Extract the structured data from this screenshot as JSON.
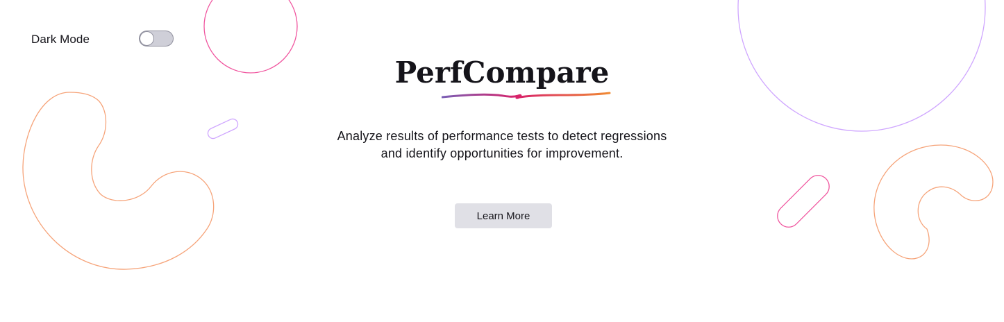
{
  "theme_toggle": {
    "label": "Dark Mode",
    "enabled": false
  },
  "hero": {
    "title": "PerfCompare",
    "description_line1": "Analyze results of performance tests to detect regressions",
    "description_line2": "and identify opportunities for improvement.",
    "learn_more_label": "Learn More"
  },
  "colors": {
    "text": "#15141a",
    "button_bg": "#e0e0e6",
    "shape_pink": "#f0569f",
    "shape_orange": "#f6a47a",
    "shape_violet": "#cfa6ff",
    "underline_start": "#7a5fb5",
    "underline_mid": "#d8226a",
    "underline_end": "#f08a33"
  }
}
